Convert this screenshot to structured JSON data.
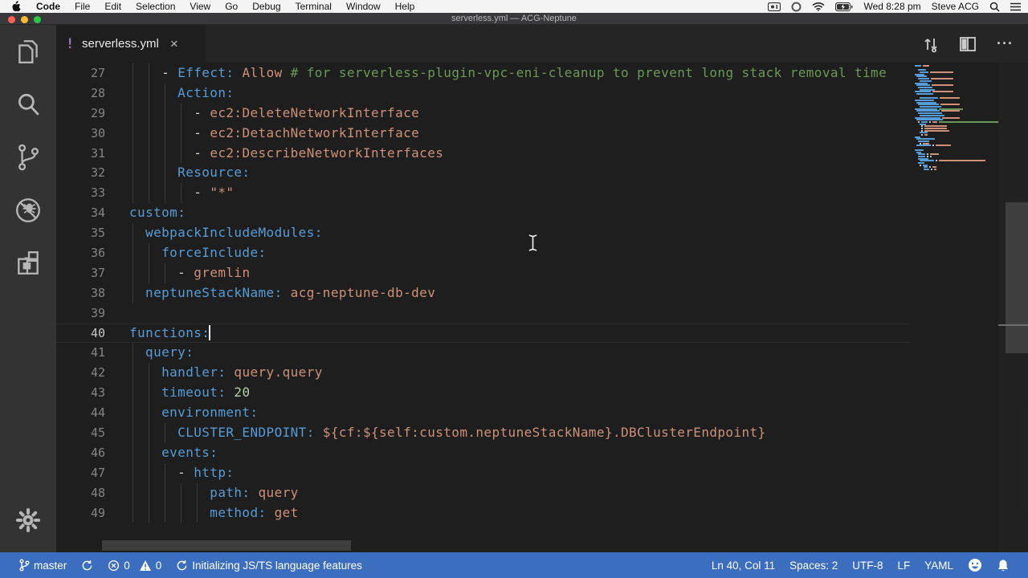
{
  "menu_bar": {
    "apple_icon": "apple-logo",
    "items": [
      "Code",
      "File",
      "Edit",
      "Selection",
      "View",
      "Go",
      "Debug",
      "Terminal",
      "Window",
      "Help"
    ],
    "clock": "Wed 8:28 pm",
    "user": "Steve ACG"
  },
  "window": {
    "title": "serverless.yml — ACG-Neptune"
  },
  "activity_bar": {
    "icons": [
      "explorer",
      "search",
      "source-control",
      "debug",
      "extensions",
      "settings-gear"
    ]
  },
  "tab_bar": {
    "active_tab": {
      "icon": "!",
      "label": "serverless.yml",
      "close": "×"
    }
  },
  "editor": {
    "cursor": {
      "line": 40,
      "col": 11
    },
    "lines": [
      {
        "num": 27,
        "indent": 4,
        "tokens": [
          [
            "d",
            "- "
          ],
          [
            "k",
            "Effect:"
          ],
          [
            "d",
            " "
          ],
          [
            "s",
            "Allow "
          ],
          [
            "c",
            "# for serverless-plugin-vpc-eni-cleanup to prevent long stack removal time"
          ]
        ]
      },
      {
        "num": 28,
        "indent": 6,
        "tokens": [
          [
            "k",
            "Action:"
          ]
        ]
      },
      {
        "num": 29,
        "indent": 8,
        "tokens": [
          [
            "d",
            "- "
          ],
          [
            "s",
            "ec2:DeleteNetworkInterface"
          ]
        ]
      },
      {
        "num": 30,
        "indent": 8,
        "tokens": [
          [
            "d",
            "- "
          ],
          [
            "s",
            "ec2:DetachNetworkInterface"
          ]
        ]
      },
      {
        "num": 31,
        "indent": 8,
        "tokens": [
          [
            "d",
            "- "
          ],
          [
            "s",
            "ec2:DescribeNetworkInterfaces"
          ]
        ]
      },
      {
        "num": 32,
        "indent": 6,
        "tokens": [
          [
            "k",
            "Resource:"
          ]
        ]
      },
      {
        "num": 33,
        "indent": 8,
        "tokens": [
          [
            "d",
            "- "
          ],
          [
            "s",
            "\"*\""
          ]
        ]
      },
      {
        "num": 34,
        "indent": 0,
        "tokens": [
          [
            "k",
            "custom:"
          ]
        ]
      },
      {
        "num": 35,
        "indent": 2,
        "tokens": [
          [
            "k",
            "webpackIncludeModules:"
          ]
        ]
      },
      {
        "num": 36,
        "indent": 4,
        "tokens": [
          [
            "k",
            "forceInclude:"
          ]
        ]
      },
      {
        "num": 37,
        "indent": 6,
        "tokens": [
          [
            "d",
            "- "
          ],
          [
            "s",
            "gremlin"
          ]
        ]
      },
      {
        "num": 38,
        "indent": 2,
        "tokens": [
          [
            "k",
            "neptuneStackName:"
          ],
          [
            "d",
            " "
          ],
          [
            "s",
            "acg-neptune-db-dev"
          ]
        ]
      },
      {
        "num": 39,
        "indent": 0,
        "tokens": []
      },
      {
        "num": 40,
        "indent": 0,
        "tokens": [
          [
            "k",
            "functions:"
          ]
        ]
      },
      {
        "num": 41,
        "indent": 2,
        "tokens": [
          [
            "k",
            "query:"
          ]
        ]
      },
      {
        "num": 42,
        "indent": 4,
        "tokens": [
          [
            "k",
            "handler:"
          ],
          [
            "d",
            " "
          ],
          [
            "s",
            "query.query"
          ]
        ]
      },
      {
        "num": 43,
        "indent": 4,
        "tokens": [
          [
            "k",
            "timeout:"
          ],
          [
            "d",
            " "
          ],
          [
            "n",
            "20"
          ]
        ]
      },
      {
        "num": 44,
        "indent": 4,
        "tokens": [
          [
            "k",
            "environment:"
          ]
        ]
      },
      {
        "num": 45,
        "indent": 6,
        "tokens": [
          [
            "k",
            "CLUSTER_ENDPOINT:"
          ],
          [
            "d",
            " "
          ],
          [
            "s",
            "${cf:${self:custom.neptuneStackName}.DBClusterEndpoint}"
          ]
        ]
      },
      {
        "num": 46,
        "indent": 4,
        "tokens": [
          [
            "k",
            "events:"
          ]
        ]
      },
      {
        "num": 47,
        "indent": 6,
        "tokens": [
          [
            "d",
            "- "
          ],
          [
            "k",
            "http:"
          ]
        ]
      },
      {
        "num": 48,
        "indent": 10,
        "tokens": [
          [
            "k",
            "path:"
          ],
          [
            "d",
            " "
          ],
          [
            "s",
            "query"
          ]
        ]
      },
      {
        "num": 49,
        "indent": 10,
        "tokens": [
          [
            "k",
            "method:"
          ],
          [
            "d",
            " "
          ],
          [
            "s",
            "get"
          ]
        ]
      }
    ]
  },
  "status_bar": {
    "branch": "master",
    "errors": "0",
    "warnings": "0",
    "message": "Initializing JS/TS language features",
    "cursor_position": "Ln 40, Col 11",
    "indentation": "Spaces: 2",
    "encoding": "UTF-8",
    "eol": "LF",
    "language": "YAML"
  },
  "colors": {
    "status_bar_bg": "#3c6ec0",
    "editor_bg": "#1e1e1e",
    "yaml_key": "#569cd6",
    "yaml_string": "#ce9178",
    "yaml_number": "#b5cea8",
    "comment": "#6a9955",
    "plain": "#d4d4d4",
    "tab_icon_purple": "#a074c4"
  }
}
